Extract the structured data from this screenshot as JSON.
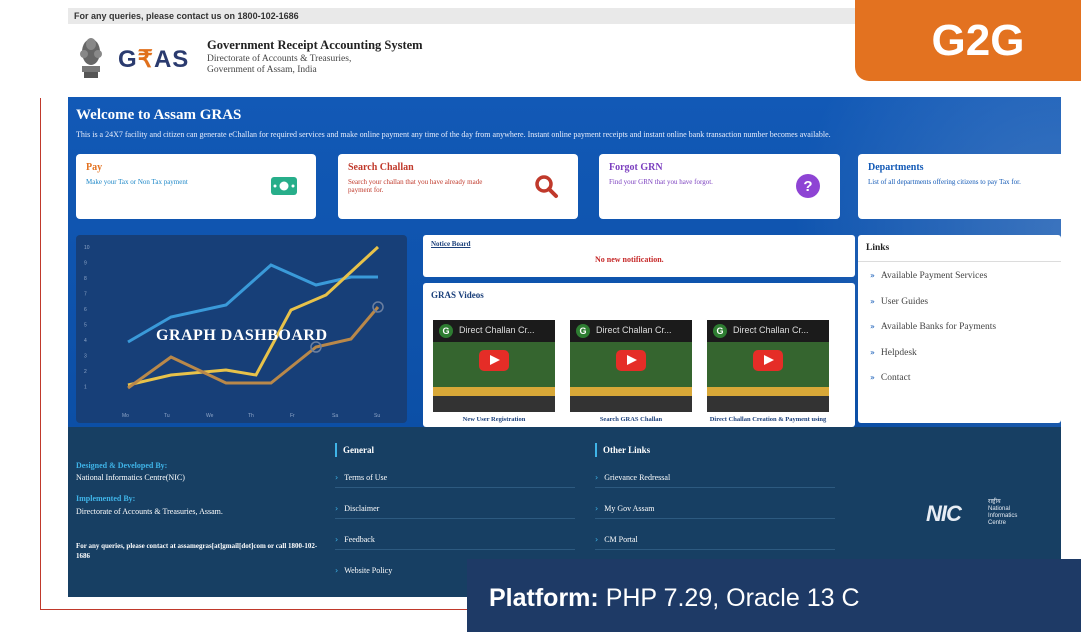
{
  "topbar": {
    "text": "For any queries, please contact us on 1800-102-1686"
  },
  "header": {
    "logo_prefix": "G",
    "logo_mid": "₹",
    "logo_suffix": "AS",
    "title": "Government Receipt Accounting System",
    "subtitle_line1": "Directorate of Accounts & Treasuries,",
    "subtitle_line2": "Government of Assam, India"
  },
  "tag": {
    "label": "G2G",
    "color": "#e37220"
  },
  "banner": {
    "welcome": "Welcome to Assam GRAS",
    "description": "This is a 24X7 facility and citizen can generate eChallan for required services and make online payment any time of the day from anywhere. Instant online payment receipts and instant online bank transaction number becomes available."
  },
  "cards": [
    {
      "title": "Pay",
      "desc": "Make your Tax or Non Tax payment",
      "title_color": "#e37220",
      "desc_color": "#1e88c8",
      "icon": "money-icon"
    },
    {
      "title": "Search Challan",
      "desc": "Search your challan that you have already made payment for.",
      "title_color": "#c0392b",
      "desc_color": "#c0392b",
      "icon": "search-icon"
    },
    {
      "title": "Forgot GRN",
      "desc": "Find your GRN that you have forgot.",
      "title_color": "#7b3fbf",
      "desc_color": "#7b3fbf",
      "icon": "question-icon"
    },
    {
      "title": "Departments",
      "desc": "List of all departments offering citizens to pay Tax for.",
      "title_color": "#1259b6",
      "desc_color": "#1259b6",
      "icon": "building-icon"
    }
  ],
  "graph": {
    "label": "GRAPH DASHBOARD",
    "y_ticks": [
      "10",
      "9",
      "8",
      "7",
      "6",
      "5",
      "4",
      "3",
      "2",
      "1"
    ],
    "x_ticks": [
      "Mo",
      "Tu",
      "We",
      "Th",
      "Fr",
      "Sa",
      "Su"
    ]
  },
  "notice": {
    "title": "Notice Board",
    "message": "No new notification."
  },
  "videos": {
    "title": "GRAS Videos",
    "items": [
      {
        "thumb_title": "Direct Challan Cr...",
        "caption": "New User Registration"
      },
      {
        "thumb_title": "Direct Challan Cr...",
        "caption": "Search GRAS Challan"
      },
      {
        "thumb_title": "Direct Challan Cr...",
        "caption": "Direct Challan Creation & Payment using"
      }
    ]
  },
  "links": {
    "title": "Links",
    "items": [
      "Available Payment Services",
      "User Guides",
      "Available Banks for Payments",
      "Helpdesk",
      "Contact"
    ]
  },
  "footer": {
    "designed_heading": "Designed & Developed By:",
    "designed_by": "National Informatics Centre(NIC)",
    "implemented_heading": "Implemented By:",
    "implemented_by": "Directorate of Accounts & Treasuries, Assam.",
    "contact": "For any queries, please contact at assamegras[at]gmail[dot]com or call 1800-102-1686",
    "general": {
      "heading": "General",
      "items": [
        "Terms of Use",
        "Disclaimer",
        "Feedback",
        "Website Policy"
      ]
    },
    "other": {
      "heading": "Other Links",
      "items": [
        "Grievance Redressal",
        "My Gov Assam",
        "CM Portal"
      ]
    },
    "nic_logo": "NIC",
    "nic_hindi": "राष्ट्रीय",
    "nic_line1": "National",
    "nic_line2": "Informatics",
    "nic_line3": "Centre"
  },
  "platform": {
    "label": "Platform:",
    "value": "PHP 7.29, Oracle 13 C"
  }
}
